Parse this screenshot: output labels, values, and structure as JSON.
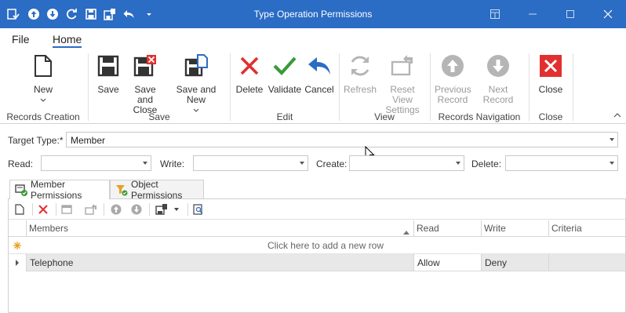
{
  "window": {
    "title": "Type Operation Permissions"
  },
  "menu": {
    "file": "File",
    "home": "Home"
  },
  "ribbon": {
    "new": "New",
    "save": "Save",
    "save_and_close_1": "Save and",
    "save_and_close_2": "Close",
    "save_and_new": "Save and New",
    "delete": "Delete",
    "validate": "Validate",
    "cancel": "Cancel",
    "refresh": "Refresh",
    "reset_view_1": "Reset View",
    "reset_view_2": "Settings",
    "previous_record_1": "Previous",
    "previous_record_2": "Record",
    "next_record": "Next Record",
    "close": "Close",
    "groups": {
      "records_creation": "Records Creation",
      "save": "Save",
      "edit": "Edit",
      "view": "View",
      "records_navigation": "Records Navigation",
      "close": "Close"
    }
  },
  "form": {
    "target_type_label": "Target Type:*",
    "target_type_value": "Member",
    "read_label": "Read:",
    "write_label": "Write:",
    "create_label": "Create:",
    "delete_label": "Delete:"
  },
  "tabs": {
    "member_permissions": "Member Permissions",
    "object_permissions": "Object Permissions"
  },
  "grid": {
    "columns": [
      "Members",
      "Read",
      "Write",
      "Criteria"
    ],
    "new_row_text": "Click here to add a new row",
    "rows": [
      {
        "members": "Telephone",
        "read": "Allow",
        "write": "Deny",
        "criteria": ""
      }
    ]
  },
  "colors": {
    "titlebar": "#2b6cc4",
    "delete_red": "#e0302f",
    "validate_green": "#3a9a3a",
    "cancel_blue": "#2b6cc4",
    "close_red": "#e0302f"
  }
}
